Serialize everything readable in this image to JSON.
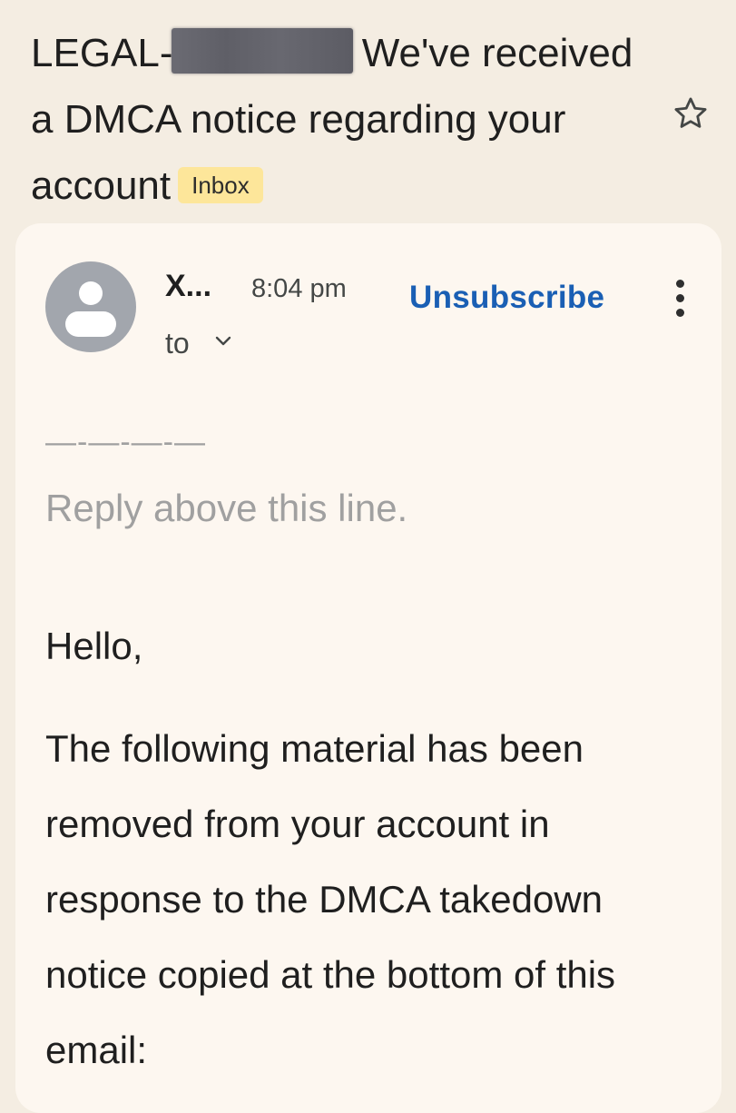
{
  "subject": {
    "prefix": "LEGAL-",
    "rest": " We've received a DMCA notice regarding your account",
    "label_badge": "Inbox"
  },
  "message": {
    "sender_short": "X...",
    "time": "8:04 pm",
    "unsubscribe_label": "Unsubscribe",
    "to_label": "to",
    "divider": "—-—-—-—",
    "reply_hint": "Reply above this line.",
    "greeting": "Hello,",
    "body": "The following material has been removed from your account in response to the DMCA takedown notice copied at the bottom of this email:"
  },
  "icons": {
    "star": "star-outline-icon",
    "more": "more-vert-icon",
    "expand": "chevron-down-icon",
    "avatar": "person-avatar-icon"
  },
  "colors": {
    "background": "#f4ede2",
    "card": "#fdf7f0",
    "link": "#1a5fb4",
    "badge": "#fde69a",
    "avatar": "#a2a6ad"
  }
}
